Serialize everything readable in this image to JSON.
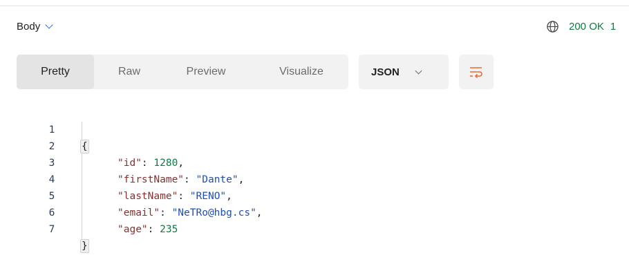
{
  "header": {
    "body_label": "Body",
    "status": "200 OK",
    "status_extra": "1",
    "status_color": "#0c7a43"
  },
  "view_tabs": [
    {
      "label": "Pretty",
      "active": true
    },
    {
      "label": "Raw",
      "active": false
    },
    {
      "label": "Preview",
      "active": false
    },
    {
      "label": "Visualize",
      "active": false
    }
  ],
  "format": {
    "selected": "JSON"
  },
  "icons": {
    "body_dropdown": "chevron-down-icon",
    "status": "globe-icon",
    "format_dropdown": "chevron-down-icon",
    "wrap": "wrap-lines-icon"
  },
  "response_lines": [
    {
      "number": "1",
      "open_brace": "{"
    },
    {
      "number": "2",
      "key": "\"id\"",
      "sep": ": ",
      "value": "1280",
      "value_type": "number",
      "trail": ","
    },
    {
      "number": "3",
      "key": "\"firstName\"",
      "sep": ": ",
      "value": "\"Dante\"",
      "value_type": "string",
      "trail": ","
    },
    {
      "number": "4",
      "key": "\"lastName\"",
      "sep": ": ",
      "value": "\"RENO\"",
      "value_type": "string",
      "trail": ","
    },
    {
      "number": "5",
      "key": "\"email\"",
      "sep": ": ",
      "value": "\"NeTRo@hbg.cs\"",
      "value_type": "string",
      "trail": ","
    },
    {
      "number": "6",
      "key": "\"age\"",
      "sep": ": ",
      "value": "235",
      "value_type": "number",
      "trail": ""
    },
    {
      "number": "7",
      "close_brace": "}"
    }
  ]
}
